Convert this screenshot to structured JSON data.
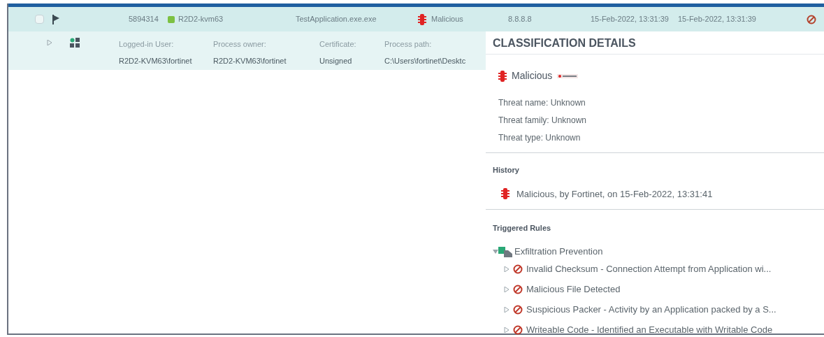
{
  "event_row": {
    "selected": false,
    "flagged": true,
    "id": "5894314",
    "device": {
      "name": "R2D2-kvm63",
      "color": "#7cc142"
    },
    "process": "TestApplication.exe.exe",
    "classification": "Malicious",
    "destination": "8.8.8.8",
    "first_seen": "15-Feb-2022, 13:31:39",
    "last_seen": "15-Feb-2022, 13:31:39"
  },
  "detail_row": {
    "expanded": false,
    "fields": [
      {
        "label": "Logged-in User:",
        "value": "R2D2-KVM63\\fortinet"
      },
      {
        "label": "Process owner:",
        "value": "R2D2-KVM63\\fortinet"
      },
      {
        "label": "Certificate:",
        "value": "Unsigned"
      },
      {
        "label": "Process path:",
        "value": "C:\\Users\\fortinet\\Desktc"
      }
    ]
  },
  "panel": {
    "title": "CLASSIFICATION DETAILS",
    "classification": "Malicious",
    "threat_lines": [
      "Threat name: Unknown",
      "Threat family: Unknown",
      "Threat type: Unknown"
    ],
    "history_title": "History",
    "history": [
      "Malicious, by Fortinet, on 15-Feb-2022, 13:31:41"
    ],
    "rules_title": "Triggered Rules",
    "rules": [
      {
        "label": "Exfiltration Prevention",
        "expanded": true,
        "children": [
          {
            "label": "Invalid Checksum - Connection Attempt from Application wi...",
            "expanded": false
          },
          {
            "label": "Malicious File Detected",
            "expanded": false
          },
          {
            "label": "Suspicious Packer - Activity by an Application packed by a S...",
            "expanded": false
          },
          {
            "label": "Writeable Code - Identified an Executable with Writable Code",
            "expanded": false
          }
        ]
      }
    ]
  }
}
